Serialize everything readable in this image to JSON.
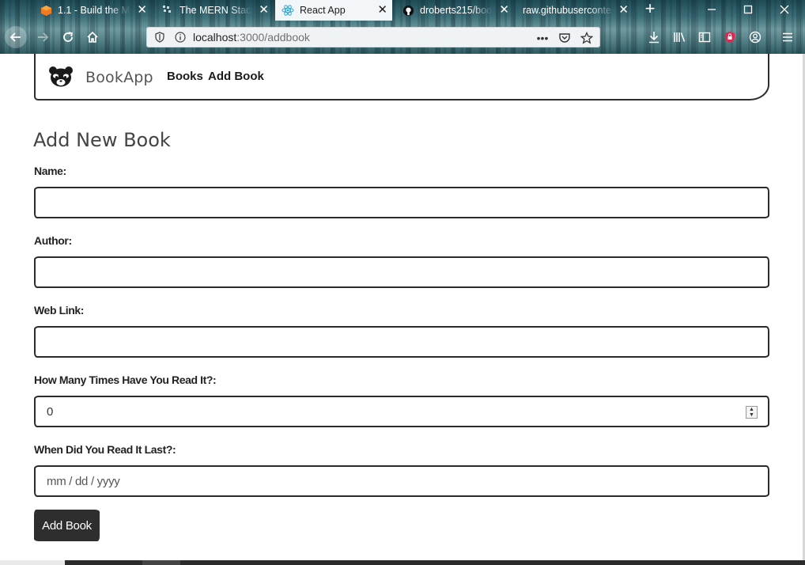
{
  "browser": {
    "tabs": [
      {
        "title": "1.1 - Build the ME",
        "icon": "orange-cube-icon",
        "active": false
      },
      {
        "title": "The MERN Stack",
        "icon": "grid-icon",
        "active": false
      },
      {
        "title": "React App",
        "icon": "react-icon",
        "active": true
      },
      {
        "title": "droberts215/book",
        "icon": "github-icon",
        "active": false
      },
      {
        "title": "raw.githubuserconte",
        "icon": "",
        "active": false
      }
    ],
    "url_host": "localhost",
    "url_path": ":3000/addbook",
    "colors": {
      "accent_tab": "#f3f6f8",
      "shield_red": "#e22850"
    }
  },
  "app": {
    "brand": "BookApp",
    "nav_links": [
      "Books",
      "Add Book"
    ]
  },
  "form": {
    "title": "Add New Book",
    "name_label": "Name:",
    "name_value": "",
    "author_label": "Author:",
    "author_value": "",
    "weblink_label": "Web Link:",
    "weblink_value": "",
    "times_label": "How Many Times Have You Read It?:",
    "times_value": "0",
    "lastread_label": "When Did You Read It Last?:",
    "lastread_placeholder": "mm / dd / yyyy",
    "submit_label": "Add Book"
  }
}
